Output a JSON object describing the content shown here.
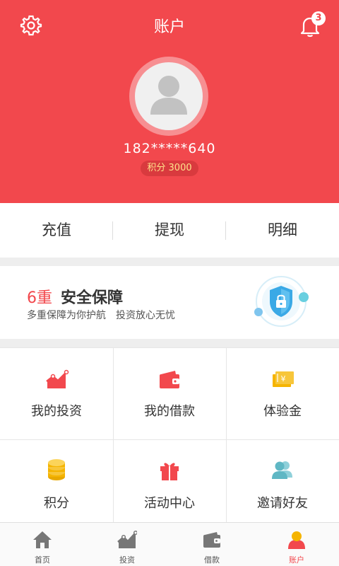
{
  "header": {
    "title": "账户",
    "notification_count": "3",
    "phone": "182*****640",
    "points_label": "积分 3000"
  },
  "actions": [
    {
      "label": "充值"
    },
    {
      "label": "提现"
    },
    {
      "label": "明细"
    }
  ],
  "security": {
    "count": "6重",
    "title": "安全保障",
    "subtitle": "多重保障为你护航　投资放心无忧"
  },
  "grid": [
    {
      "label": "我的投资",
      "icon": "investment-chart-icon"
    },
    {
      "label": "我的借款",
      "icon": "wallet-icon"
    },
    {
      "label": "体验金",
      "icon": "ticket-icon"
    },
    {
      "label": "积分",
      "icon": "coins-icon"
    },
    {
      "label": "活动中心",
      "icon": "gift-icon"
    },
    {
      "label": "邀请好友",
      "icon": "invite-friends-icon"
    }
  ],
  "tabbar": [
    {
      "label": "首页",
      "icon": "home-icon"
    },
    {
      "label": "投资",
      "icon": "chart-icon"
    },
    {
      "label": "借款",
      "icon": "wallet-icon"
    },
    {
      "label": "账户",
      "icon": "account-icon",
      "active": true
    }
  ],
  "colors": {
    "brand_red": "#f2484d",
    "gold": "#f5b400",
    "teal": "#5fb7c4"
  }
}
